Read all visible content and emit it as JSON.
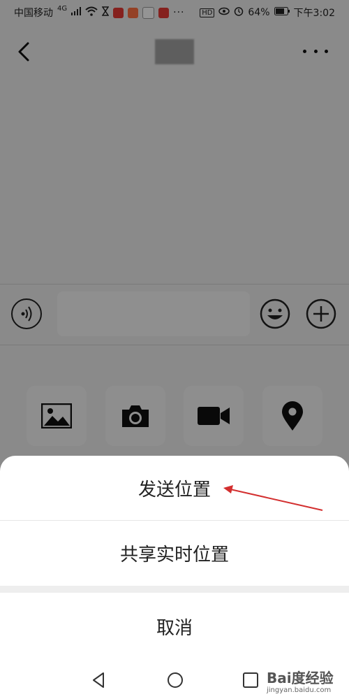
{
  "status_bar": {
    "carrier": "中国移动",
    "network": "4G",
    "battery": "64%",
    "time": "下午3:02",
    "hd": "HD",
    "icons": [
      "wifi-icon",
      "hourglass-icon",
      "notification-icon",
      "notification-icon",
      "chat-icon",
      "notification-icon",
      "more-icon",
      "eye-icon",
      "alarm-icon",
      "battery-icon"
    ]
  },
  "top_nav": {
    "back_icon": "chevron-left-icon",
    "title": "",
    "more_icon": "more-dots-icon"
  },
  "input_bar": {
    "voice_icon": "voice-icon",
    "text_value": "",
    "emoji_icon": "emoji-icon",
    "plus_icon": "plus-circle-icon"
  },
  "tools": [
    {
      "icon": "image-icon"
    },
    {
      "icon": "camera-icon"
    },
    {
      "icon": "video-icon"
    },
    {
      "icon": "location-icon"
    }
  ],
  "action_sheet": {
    "send_location": "发送位置",
    "share_realtime_location": "共享实时位置",
    "cancel": "取消"
  },
  "nav_bar": {
    "back_icon": "triangle-back-icon",
    "home_icon": "circle-home-icon",
    "recent_icon": "square-recent-icon"
  },
  "watermark": {
    "brand": "Bai度经验",
    "url": "jingyan.baidu.com"
  },
  "colors": {
    "annotation_arrow": "#d32f2f",
    "overlay": "rgba(0,0,0,0.42)"
  }
}
